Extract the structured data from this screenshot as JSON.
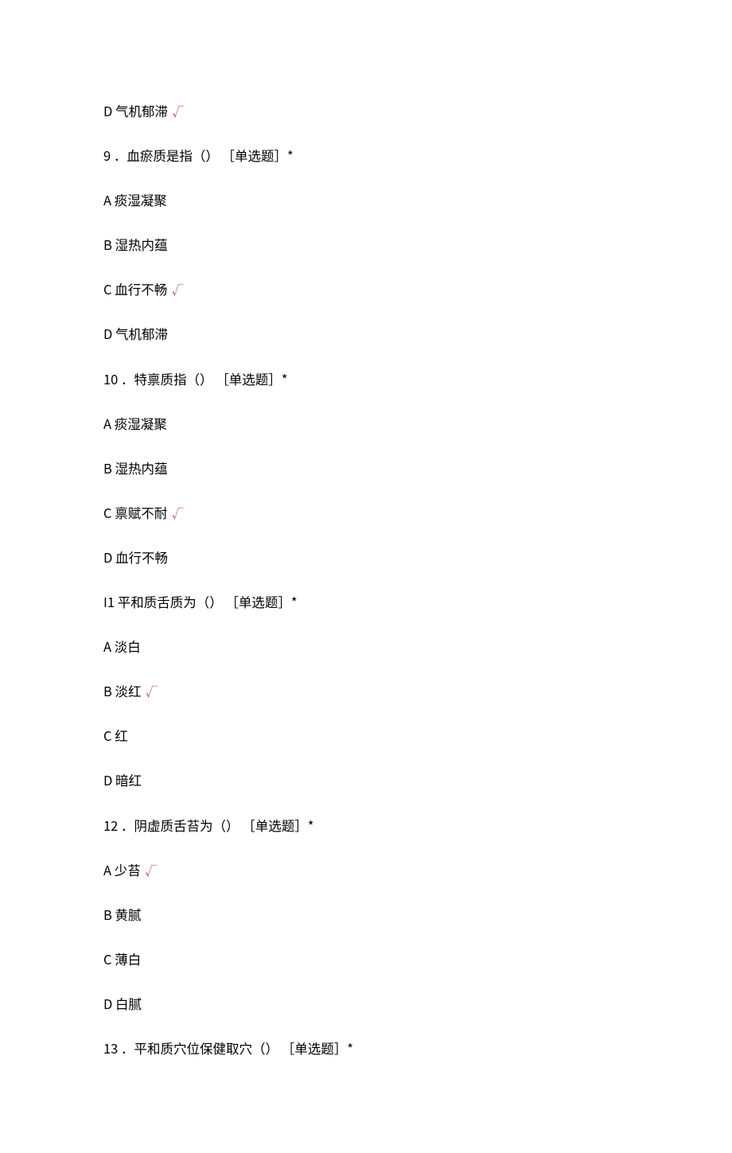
{
  "lines": [
    {
      "text": "D 气机郁滞",
      "correct": true
    },
    {
      "text": "9 ．血瘀质是指（） ［单选题］*",
      "correct": false
    },
    {
      "text": "A 痰湿凝聚",
      "correct": false
    },
    {
      "text": "B 湿热内蕴",
      "correct": false
    },
    {
      "text": "C 血行不畅",
      "correct": true
    },
    {
      "text": "D 气机郁滞",
      "correct": false
    },
    {
      "text": "10 ．特禀质指（） ［单选题］*",
      "correct": false
    },
    {
      "text": "A 痰湿凝聚",
      "correct": false
    },
    {
      "text": "B 湿热内蕴",
      "correct": false
    },
    {
      "text": "C 禀赋不耐",
      "correct": true
    },
    {
      "text": "D 血行不畅",
      "correct": false
    },
    {
      "text": "I1 平和质舌质为（） ［单选题］*",
      "correct": false
    },
    {
      "text": "A 淡白",
      "correct": false
    },
    {
      "text": "B 淡红",
      "correct": true
    },
    {
      "text": "C 红",
      "correct": false
    },
    {
      "text": "D 暗红",
      "correct": false
    },
    {
      "text": "12 ．阴虚质舌苔为（） ［单选题］*",
      "correct": false
    },
    {
      "text": "A 少苔",
      "correct": true
    },
    {
      "text": "B 黄腻",
      "correct": false
    },
    {
      "text": "C 薄白",
      "correct": false
    },
    {
      "text": "D 白腻",
      "correct": false
    },
    {
      "text": "13 ．平和质穴位保健取穴（） ［单选题］*",
      "correct": false
    }
  ],
  "checkmark": "√"
}
